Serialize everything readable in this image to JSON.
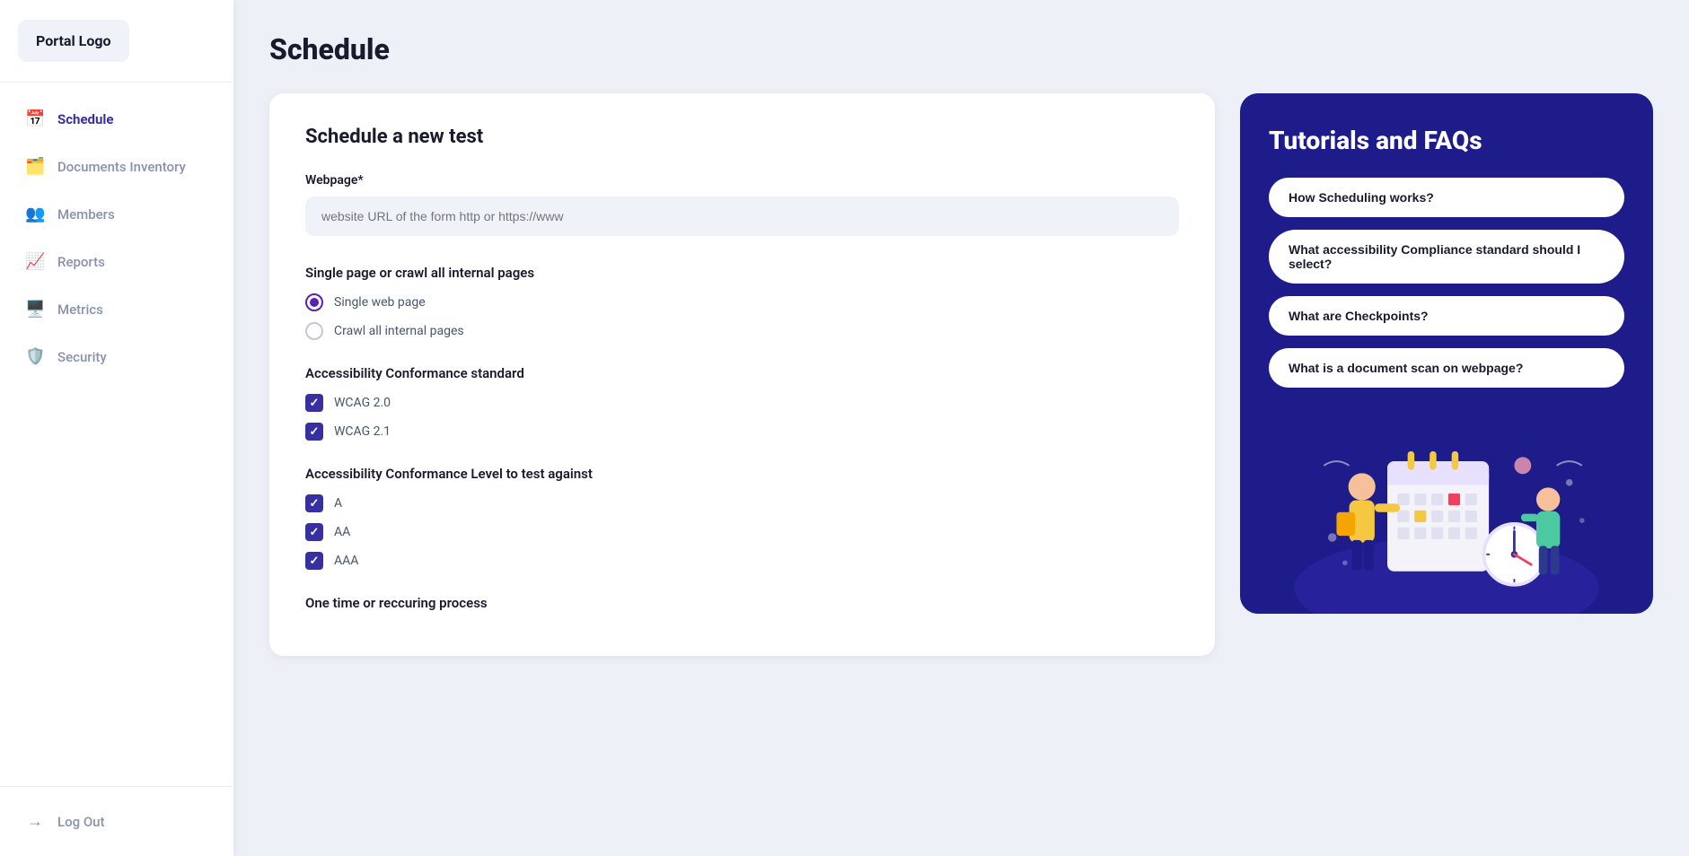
{
  "sidebar": {
    "logo": "Portal Logo",
    "items": [
      {
        "id": "schedule",
        "label": "Schedule",
        "icon": "📅",
        "active": true
      },
      {
        "id": "documents",
        "label": "Documents Inventory",
        "icon": "🗂️",
        "active": false
      },
      {
        "id": "members",
        "label": "Members",
        "icon": "👥",
        "active": false
      },
      {
        "id": "reports",
        "label": "Reports",
        "icon": "📈",
        "active": false
      },
      {
        "id": "metrics",
        "label": "Metrics",
        "icon": "🖥️",
        "active": false
      },
      {
        "id": "security",
        "label": "Security",
        "icon": "🛡️",
        "active": false
      }
    ],
    "logout": "Log Out"
  },
  "page": {
    "title": "Schedule"
  },
  "form": {
    "section_title": "Schedule a new test",
    "webpage_label": "Webpage*",
    "webpage_placeholder": "website URL of the form http or https://www",
    "crawl_label": "Single page or crawl all internal pages",
    "crawl_options": [
      {
        "id": "single",
        "label": "Single web page",
        "checked": true
      },
      {
        "id": "crawl",
        "label": "Crawl all internal pages",
        "checked": false
      }
    ],
    "conformance_standard_label": "Accessibility Conformance standard",
    "standards": [
      {
        "id": "wcag20",
        "label": "WCAG 2.0",
        "checked": true
      },
      {
        "id": "wcag21",
        "label": "WCAG 2.1",
        "checked": true
      }
    ],
    "conformance_level_label": "Accessibility Conformance Level to test against",
    "levels": [
      {
        "id": "a",
        "label": "A",
        "checked": true
      },
      {
        "id": "aa",
        "label": "AA",
        "checked": true
      },
      {
        "id": "aaa",
        "label": "AAA",
        "checked": true
      }
    ],
    "process_label": "One time or reccuring process"
  },
  "tutorials": {
    "title": "Tutorials and FAQs",
    "faqs": [
      {
        "id": "faq1",
        "label": "How Scheduling works?"
      },
      {
        "id": "faq2",
        "label": "What accessibility Compliance standard should I select?"
      },
      {
        "id": "faq3",
        "label": "What are Checkpoints?"
      },
      {
        "id": "faq4",
        "label": "What is a document scan on webpage?"
      }
    ]
  }
}
